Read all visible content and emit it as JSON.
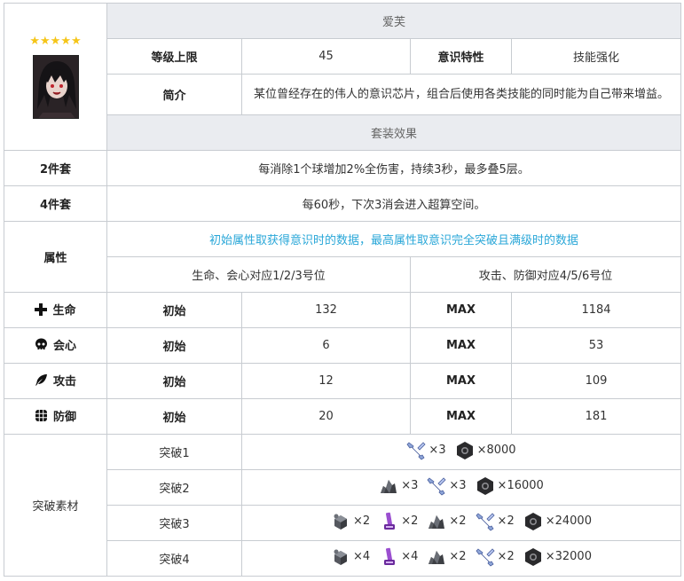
{
  "rarity_stars": "★★★★★",
  "name": "爱芙",
  "info": {
    "level_cap_label": "等级上限",
    "level_cap_value": "45",
    "trait_label": "意识特性",
    "trait_value": "技能强化",
    "intro_label": "简介",
    "intro_text": "某位曾经存在的伟人的意识芯片，组合后使用各类技能的同时能为自己带来增益。"
  },
  "set_effect": {
    "header": "套装效果",
    "two_label": "2件套",
    "two_text": "每消除1个球增加2%全伤害，持续3秒，最多叠5层。",
    "four_label": "4件套",
    "four_text": "每60秒，下次3消会进入超算空间。"
  },
  "attributes": {
    "label": "属性",
    "note": "初始属性取获得意识时的数据，最高属性取意识完全突破且满级时的数据",
    "left_slots": "生命、会心对应1/2/3号位",
    "right_slots": "攻击、防御对应4/5/6号位",
    "initial_label": "初始",
    "max_label": "MAX",
    "rows": [
      {
        "name": "生命",
        "icon": "cross-icon",
        "initial": "132",
        "max": "1184"
      },
      {
        "name": "会心",
        "icon": "skull-icon",
        "initial": "6",
        "max": "53"
      },
      {
        "name": "攻击",
        "icon": "feather-icon",
        "initial": "12",
        "max": "109"
      },
      {
        "name": "防御",
        "icon": "shield-grid-icon",
        "initial": "20",
        "max": "181"
      }
    ]
  },
  "breakthrough": {
    "label": "突破素材",
    "rows": [
      {
        "stage": "突破1",
        "items": [
          {
            "icon": "crystal-wrench-icon",
            "qty": "×3"
          },
          {
            "icon": "hex-nut-icon",
            "qty": "×8000"
          }
        ]
      },
      {
        "stage": "突破2",
        "items": [
          {
            "icon": "ore-chunk-icon",
            "qty": "×3"
          },
          {
            "icon": "crystal-wrench-icon",
            "qty": "×3"
          },
          {
            "icon": "hex-nut-icon",
            "qty": "×16000"
          }
        ]
      },
      {
        "stage": "突破3",
        "items": [
          {
            "icon": "metal-cube-icon",
            "qty": "×2"
          },
          {
            "icon": "purple-tool-icon",
            "qty": "×2"
          },
          {
            "icon": "ore-chunk-icon",
            "qty": "×2"
          },
          {
            "icon": "crystal-wrench-icon",
            "qty": "×2"
          },
          {
            "icon": "hex-nut-icon",
            "qty": "×24000"
          }
        ]
      },
      {
        "stage": "突破4",
        "items": [
          {
            "icon": "metal-cube-icon",
            "qty": "×4"
          },
          {
            "icon": "purple-tool-icon",
            "qty": "×4"
          },
          {
            "icon": "ore-chunk-icon",
            "qty": "×2"
          },
          {
            "icon": "crystal-wrench-icon",
            "qty": "×2"
          },
          {
            "icon": "hex-nut-icon",
            "qty": "×32000"
          }
        ]
      }
    ]
  }
}
